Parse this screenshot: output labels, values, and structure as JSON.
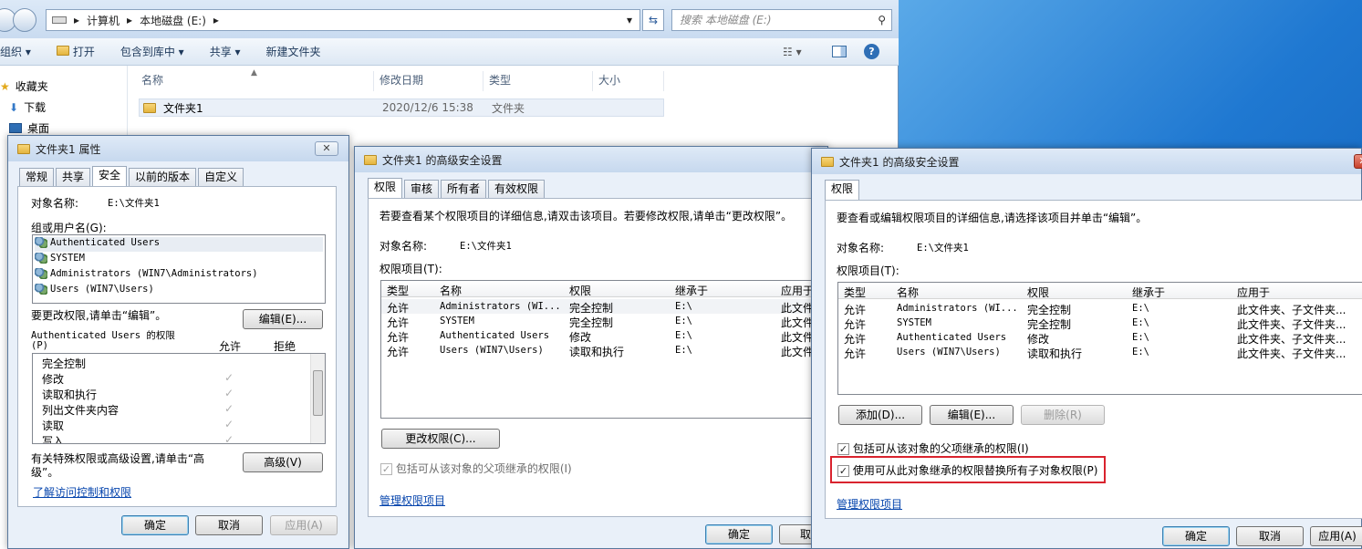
{
  "explorer": {
    "breadcrumb": [
      "计算机",
      "本地磁盘 (E:)"
    ],
    "search_placeholder": "搜索 本地磁盘 (E:)",
    "toolbar": {
      "organize": "组织 ▾",
      "open": "打开",
      "include": "包含到库中 ▾",
      "share": "共享 ▾",
      "new_folder": "新建文件夹"
    },
    "sidebar": {
      "favorites": "收藏夹",
      "downloads": "下载",
      "desktop": "桌面"
    },
    "columns": {
      "name": "名称",
      "date": "修改日期",
      "type": "类型",
      "size": "大小"
    },
    "file": {
      "name": "文件夹1",
      "date": "2020/12/6 15:38",
      "type": "文件夹"
    }
  },
  "props": {
    "title": "文件夹1 属性",
    "tabs": [
      "常规",
      "共享",
      "安全",
      "以前的版本",
      "自定义"
    ],
    "object_label": "对象名称:",
    "object_value": "E:\\文件夹1",
    "groups_label": "组或用户名(G):",
    "users": [
      "Authenticated Users",
      "SYSTEM",
      "Administrators (WIN7\\Administrators)",
      "Users (WIN7\\Users)"
    ],
    "change_text": "要更改权限,请单击“编辑”。",
    "edit_btn": "编辑(E)...",
    "perm_label": "Authenticated Users 的权限",
    "perm_label2": "(P)",
    "allow": "允许",
    "deny": "拒绝",
    "perms": [
      "完全控制",
      "修改",
      "读取和执行",
      "列出文件夹内容",
      "读取",
      "写入"
    ],
    "special_text1": "有关特殊权限或高级设置,请单击“高",
    "special_text2": "级”。",
    "advanced_btn": "高级(V)",
    "learn_link": "了解访问控制和权限",
    "ok": "确定",
    "cancel": "取消",
    "apply": "应用(A)"
  },
  "adv1": {
    "title": "文件夹1 的高级安全设置",
    "tabs": [
      "权限",
      "审核",
      "所有者",
      "有效权限"
    ],
    "info": "若要查看某个权限项目的详细信息,请双击该项目。若要修改权限,请单击“更改权限”。",
    "object_label": "对象名称:",
    "object_value": "E:\\文件夹1",
    "entries_label": "权限项目(T):",
    "cols": [
      "类型",
      "名称",
      "权限",
      "继承于",
      "应用于"
    ],
    "rows": [
      [
        "允许",
        "Administrators (WI...",
        "完全控制",
        "E:\\",
        "此文件"
      ],
      [
        "允许",
        "SYSTEM",
        "完全控制",
        "E:\\",
        "此文件"
      ],
      [
        "允许",
        "Authenticated Users",
        "修改",
        "E:\\",
        "此文件"
      ],
      [
        "允许",
        "Users (WIN7\\Users)",
        "读取和执行",
        "E:\\",
        "此文件"
      ]
    ],
    "change_btn": "更改权限(C)...",
    "inherit_text": "包括可从该对象的父项继承的权限(I)",
    "manage_link": "管理权限项目",
    "ok": "确定",
    "cancel": "取"
  },
  "adv2": {
    "title": "文件夹1 的高级安全设置",
    "tabs": [
      "权限"
    ],
    "info": "要查看或编辑权限项目的详细信息,请选择该项目并单击“编辑”。",
    "object_label": "对象名称:",
    "object_value": "E:\\文件夹1",
    "entries_label": "权限项目(T):",
    "cols": [
      "类型",
      "名称",
      "权限",
      "继承于",
      "应用于"
    ],
    "rows": [
      [
        "允许",
        "Administrators (WI...",
        "完全控制",
        "E:\\",
        "此文件夹、子文件夹..."
      ],
      [
        "允许",
        "SYSTEM",
        "完全控制",
        "E:\\",
        "此文件夹、子文件夹..."
      ],
      [
        "允许",
        "Authenticated Users",
        "修改",
        "E:\\",
        "此文件夹、子文件夹..."
      ],
      [
        "允许",
        "Users (WIN7\\Users)",
        "读取和执行",
        "E:\\",
        "此文件夹、子文件夹..."
      ]
    ],
    "add_btn": "添加(D)...",
    "edit_btn": "编辑(E)...",
    "delete_btn": "删除(R)",
    "inherit_text": "包括可从该对象的父项继承的权限(I)",
    "replace_text": "使用可从此对象继承的权限替换所有子对象权限(P)",
    "manage_link": "管理权限项目",
    "ok": "确定",
    "cancel": "取消",
    "apply": "应用(A)"
  },
  "colors": {
    "highlight": "#d9232e",
    "link": "#0645ad"
  }
}
